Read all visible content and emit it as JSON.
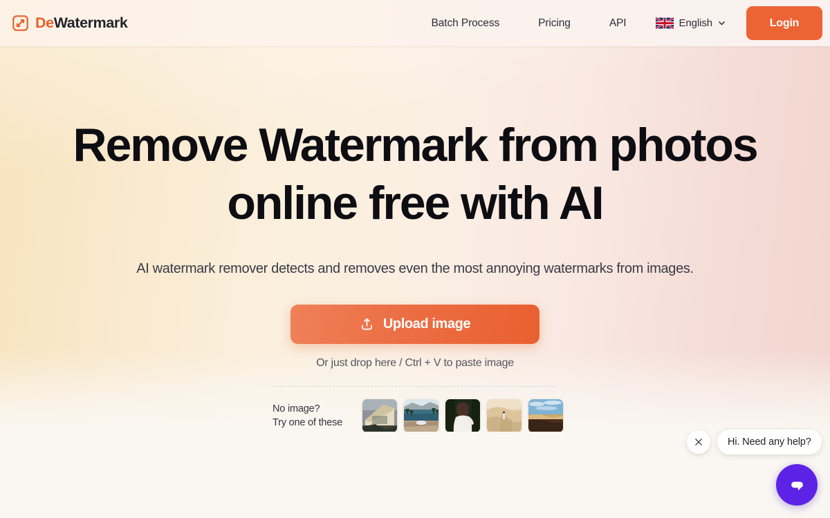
{
  "brand": {
    "name_part1": "De",
    "name_part2": "Watermark",
    "logo_icon": "watermark-square-icon",
    "accent_color": "#e8622c"
  },
  "header": {
    "nav": [
      {
        "label": "Batch Process",
        "name": "nav-batch-process"
      },
      {
        "label": "Pricing",
        "name": "nav-pricing"
      },
      {
        "label": "API",
        "name": "nav-api"
      }
    ],
    "language": {
      "label": "English",
      "flag_icon": "uk-flag-icon",
      "chevron_icon": "chevron-down-icon"
    },
    "login_label": "Login",
    "login_color": "#ec6434"
  },
  "hero": {
    "headline": "Remove Watermark from photos online free with AI",
    "subheadline": "AI watermark remover detects and removes even the most annoying watermarks from images.",
    "upload_label": "Upload image",
    "upload_icon": "upload-tray-icon",
    "drop_hint": "Or just drop here / Ctrl + V to paste image",
    "samples_label_line1": "No image?",
    "samples_label_line2": "Try one of these",
    "samples": [
      {
        "name": "sample-thumbnail-house",
        "alt": "house exterior photo"
      },
      {
        "name": "sample-thumbnail-lake",
        "alt": "lake and car photo"
      },
      {
        "name": "sample-thumbnail-portrait",
        "alt": "woman portrait photo"
      },
      {
        "name": "sample-thumbnail-desert",
        "alt": "person in desert dunes photo"
      },
      {
        "name": "sample-thumbnail-landscape",
        "alt": "desert landscape with sky photo"
      }
    ]
  },
  "chat": {
    "message": "Hi. Need any help?",
    "close_icon": "close-icon",
    "launcher_icon": "chat-bubble-icon",
    "launcher_color": "#5c23e6"
  }
}
